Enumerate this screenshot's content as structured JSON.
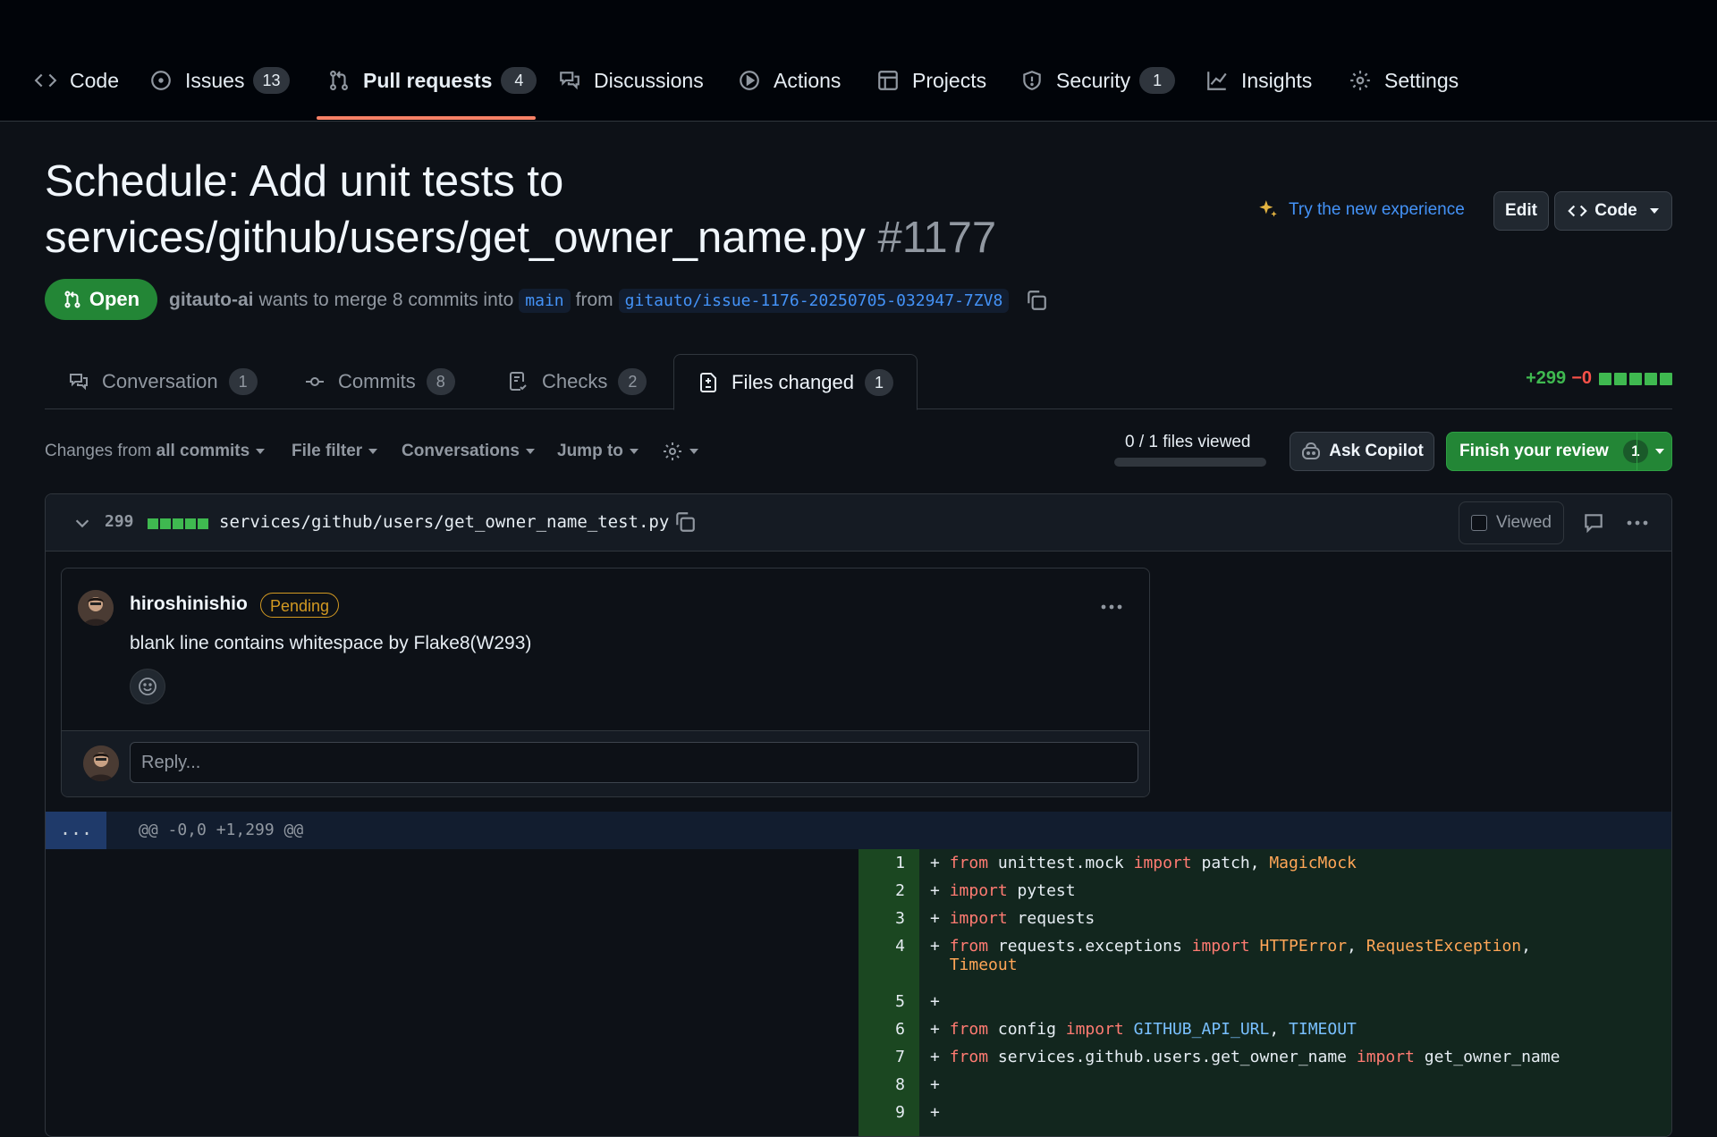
{
  "repo_nav": {
    "tabs": [
      {
        "label": "Code",
        "count": ""
      },
      {
        "label": "Issues",
        "count": "13"
      },
      {
        "label": "Pull requests",
        "count": "4",
        "active": true
      },
      {
        "label": "Discussions",
        "count": ""
      },
      {
        "label": "Actions",
        "count": ""
      },
      {
        "label": "Projects",
        "count": ""
      },
      {
        "label": "Security",
        "count": "1"
      },
      {
        "label": "Insights",
        "count": ""
      },
      {
        "label": "Settings",
        "count": ""
      }
    ]
  },
  "pr": {
    "title": "Schedule: Add unit tests to services/github/users/get_owner_name.py",
    "number": "#1177",
    "state": "Open",
    "author": "gitauto-ai",
    "merge_text": "wants to merge 8 commits into",
    "base_branch": "main",
    "from_text": "from",
    "head_branch": "gitauto/issue-1176-20250705-032947-7ZV8",
    "try_new_experience": "Try the new experience",
    "edit_label": "Edit",
    "code_label": "Code"
  },
  "pr_tabs": [
    {
      "label": "Conversation",
      "count": "1"
    },
    {
      "label": "Commits",
      "count": "8"
    },
    {
      "label": "Checks",
      "count": "2"
    },
    {
      "label": "Files changed",
      "count": "1",
      "active": true
    }
  ],
  "diffstat": {
    "additions": "+299",
    "deletions": "−0"
  },
  "toolbar": {
    "changes_from_prefix": "Changes from",
    "changes_from_value": "all commits",
    "file_filter": "File filter",
    "conversations": "Conversations",
    "jump_to": "Jump to",
    "files_viewed": "0 / 1 files viewed",
    "files_viewed_fraction": 0,
    "ask_copilot": "Ask Copilot",
    "finish_review": "Finish your review",
    "finish_review_count": "1"
  },
  "file": {
    "change_count": "299",
    "path": "services/github/users/get_owner_name_test.py",
    "viewed_label": "Viewed"
  },
  "comment": {
    "author": "hiroshinishio",
    "badge": "Pending",
    "body": "blank line contains whitespace by Flake8(W293)",
    "reply_placeholder": "Reply..."
  },
  "diff": {
    "hunk_expand": "...",
    "hunk_header": "@@ -0,0 +1,299 @@"
  },
  "colors": {
    "background": "#0d1117",
    "accent_blue": "#4493f8",
    "open_green": "#238636",
    "addition_green": "#3fb950",
    "deletion_red": "#f85149",
    "active_tab_underline": "#f78166",
    "pending": "#d29922"
  }
}
